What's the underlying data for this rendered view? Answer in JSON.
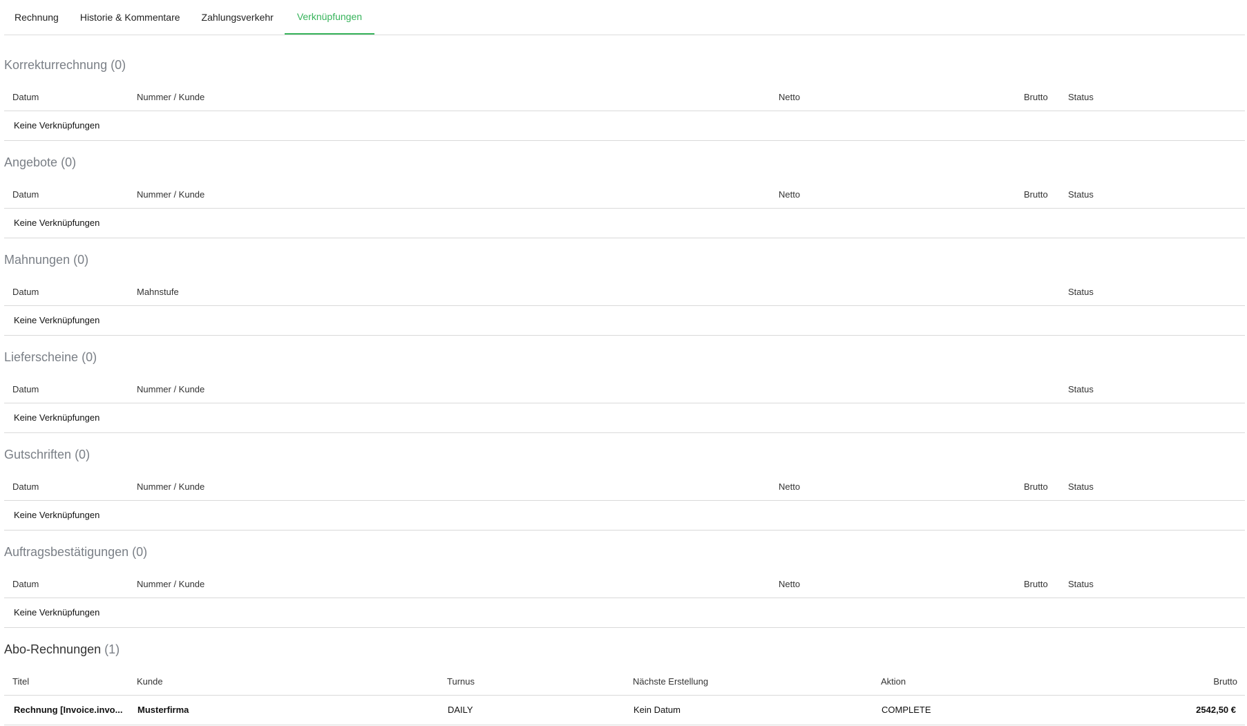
{
  "tabs": [
    {
      "label": "Rechnung"
    },
    {
      "label": "Historie & Kommentare"
    },
    {
      "label": "Zahlungsverkehr"
    },
    {
      "label": "Verknüpfungen"
    }
  ],
  "accent_color": "#36b35a",
  "empty_text": "Keine Verknüpfungen",
  "sections": {
    "korrektur": {
      "title": "Korrekturrechnung",
      "count": "(0)",
      "cols": [
        "Datum",
        "Nummer / Kunde",
        "Netto",
        "Brutto",
        "Status"
      ]
    },
    "angebote": {
      "title": "Angebote",
      "count": "(0)",
      "cols": [
        "Datum",
        "Nummer / Kunde",
        "Netto",
        "Brutto",
        "Status"
      ]
    },
    "mahnungen": {
      "title": "Mahnungen",
      "count": "(0)",
      "cols": [
        "Datum",
        "Mahnstufe",
        "Status"
      ]
    },
    "lieferscheine": {
      "title": "Lieferscheine",
      "count": "(0)",
      "cols": [
        "Datum",
        "Nummer / Kunde",
        "Status"
      ]
    },
    "gutschriften": {
      "title": "Gutschriften",
      "count": "(0)",
      "cols": [
        "Datum",
        "Nummer / Kunde",
        "Netto",
        "Brutto",
        "Status"
      ]
    },
    "auftrag": {
      "title": "Auftragsbestätigungen",
      "count": "(0)",
      "cols": [
        "Datum",
        "Nummer / Kunde",
        "Netto",
        "Brutto",
        "Status"
      ]
    },
    "abo": {
      "title": "Abo-Rechnungen",
      "count": "(1)",
      "cols": [
        "Titel",
        "Kunde",
        "Turnus",
        "Nächste Erstellung",
        "Aktion",
        "Brutto"
      ],
      "rows": [
        {
          "titel": "Rechnung [Invoice.invo...",
          "kunde": "Musterfirma",
          "turnus": "DAILY",
          "naechste": "Kein Datum",
          "aktion": "COMPLETE",
          "brutto": "2542,50 €"
        }
      ]
    }
  }
}
